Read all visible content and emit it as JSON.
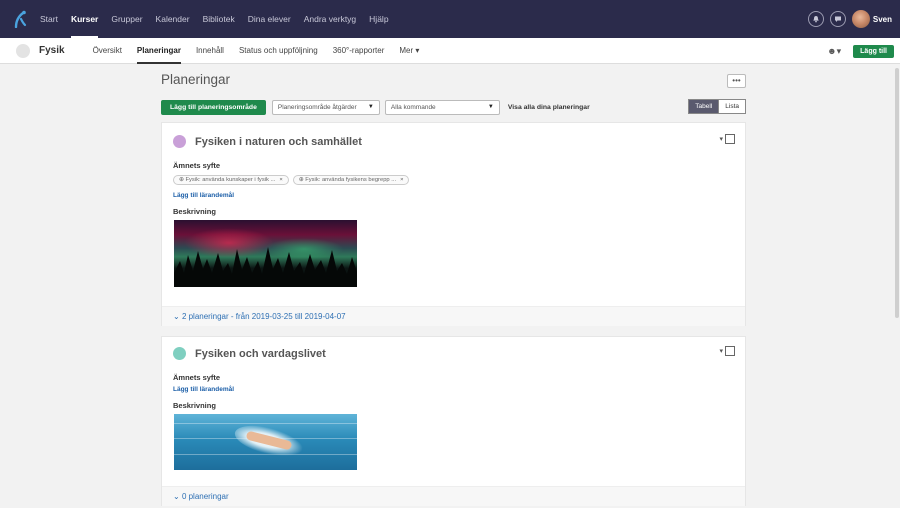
{
  "topnav": {
    "items": [
      {
        "label": "Start",
        "active": false
      },
      {
        "label": "Kurser",
        "active": true
      },
      {
        "label": "Grupper",
        "active": false
      },
      {
        "label": "Kalender",
        "active": false
      },
      {
        "label": "Bibliotek",
        "active": false
      },
      {
        "label": "Dina elever",
        "active": false
      },
      {
        "label": "Andra verktyg",
        "active": false
      },
      {
        "label": "Hjälp",
        "active": false
      }
    ],
    "user_name": "Sven",
    "bg_color": "#2b2b4b"
  },
  "subnav": {
    "course_title": "Fysik",
    "tabs": [
      {
        "label": "Översikt",
        "active": false
      },
      {
        "label": "Planeringar",
        "active": true
      },
      {
        "label": "Innehåll",
        "active": false
      },
      {
        "label": "Status och uppföljning",
        "active": false
      },
      {
        "label": "360°-rapporter",
        "active": false
      },
      {
        "label": "Mer",
        "active": false
      }
    ],
    "add_button": "Lägg till"
  },
  "main": {
    "title": "Planeringar",
    "more_label": "•••",
    "add_area_button": "Lägg till planeringsområde",
    "actions_select": "Planeringsområde åtgärder",
    "filter_select": "Alla kommande",
    "show_all": "Visa alla dina planeringar",
    "view_toggle": {
      "table": "Tabell",
      "list": "Lista",
      "selected": "Tabell"
    }
  },
  "cards": [
    {
      "title": "Fysiken i naturen och samhället",
      "dot_color": "#c9a0d8",
      "purpose_label": "Ämnets syfte",
      "chips": [
        "⊕ Fysik: använda kunskaper i fysik ...",
        "⊕ Fysik: använda fysikens begrepp ..."
      ],
      "add_goal_link": "Lägg till lärandemål",
      "description_label": "Beskrivning",
      "image": "northern-lights-forest",
      "footer": "2 planeringar - från 2019-03-25 till 2019-04-07"
    },
    {
      "title": "Fysiken och vardagslivet",
      "dot_color": "#7fcfc0",
      "purpose_label": "Ämnets syfte",
      "chips": [],
      "add_goal_link": "Lägg till lärandemål",
      "description_label": "Beskrivning",
      "image": "swimmer-pool",
      "footer": "0 planeringar"
    }
  ],
  "colors": {
    "accent_green": "#1f8a4c",
    "link_blue": "#1c5fa8",
    "toggle_active": "#5a5a6e"
  }
}
